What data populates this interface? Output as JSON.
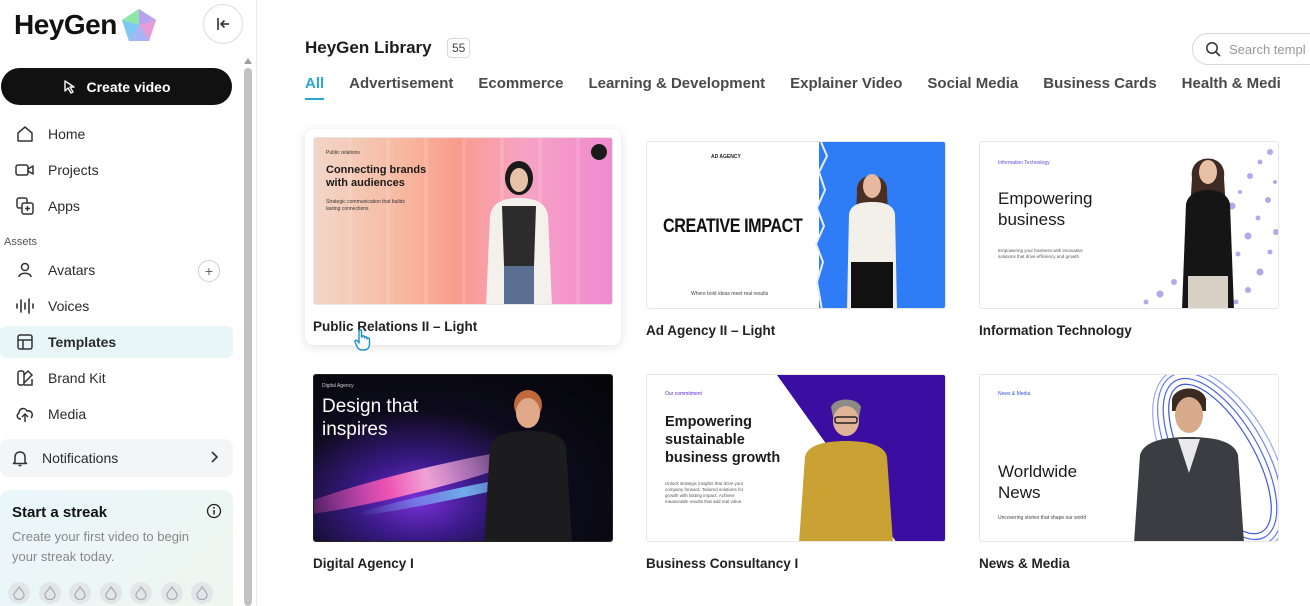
{
  "sidebar": {
    "logo_text": "HeyGen",
    "create_label": "Create video",
    "nav": [
      {
        "label": "Home",
        "icon": "home-icon"
      },
      {
        "label": "Projects",
        "icon": "video-camera-icon"
      },
      {
        "label": "Apps",
        "icon": "apps-icon"
      }
    ],
    "assets_label": "Assets",
    "assets": [
      {
        "label": "Avatars",
        "icon": "user-icon"
      },
      {
        "label": "Voices",
        "icon": "waveform-icon"
      },
      {
        "label": "Templates",
        "icon": "template-icon"
      },
      {
        "label": "Brand Kit",
        "icon": "brand-kit-icon"
      },
      {
        "label": "Media",
        "icon": "upload-cloud-icon"
      }
    ],
    "add_symbol": "+",
    "notifications_label": "Notifications",
    "streak": {
      "title": "Start a streak",
      "description": "Create your first video to begin your streak today."
    }
  },
  "library": {
    "title": "HeyGen Library",
    "count": "55",
    "search_placeholder": "Search templ",
    "tabs": [
      "All",
      "Advertisement",
      "Ecommerce",
      "Learning & Development",
      "Explainer Video",
      "Social Media",
      "Business Cards",
      "Health & Medi"
    ]
  },
  "templates": [
    {
      "label": "Public Relations II – Light",
      "kicker": "Public relations",
      "headline": "Connecting brands with audiences",
      "sub": "Strategic communication that builds lasting connections"
    },
    {
      "label": "Ad Agency II – Light",
      "kicker": "AD AGENCY",
      "headline": "CREATIVE IMPACT",
      "sub": "Where bold ideas meet real results"
    },
    {
      "label": "Information Technology",
      "kicker": "Information Technology",
      "headline": "Empowering business",
      "sub": "Empowering your business with innovative solutions that drive efficiency and growth"
    },
    {
      "label": "Digital Agency I",
      "kicker": "Digital Agency",
      "headline": "Design that inspires",
      "sub": ""
    },
    {
      "label": "Business Consultancy I",
      "kicker": "Our commitment",
      "headline": "Empowering sustainable business growth",
      "sub": "Unlock strategic insights that drive your company forward. Tailored solutions for growth with lasting impact. Achieve measurable results that add real value."
    },
    {
      "label": "News & Media",
      "kicker": "News & Media",
      "headline": "Worldwide News",
      "sub": "Uncovering stories that shape our world"
    }
  ],
  "colors": {
    "accent": "#2aa6d3",
    "dark": "#111111",
    "active_bg": "#e8f6f8"
  }
}
